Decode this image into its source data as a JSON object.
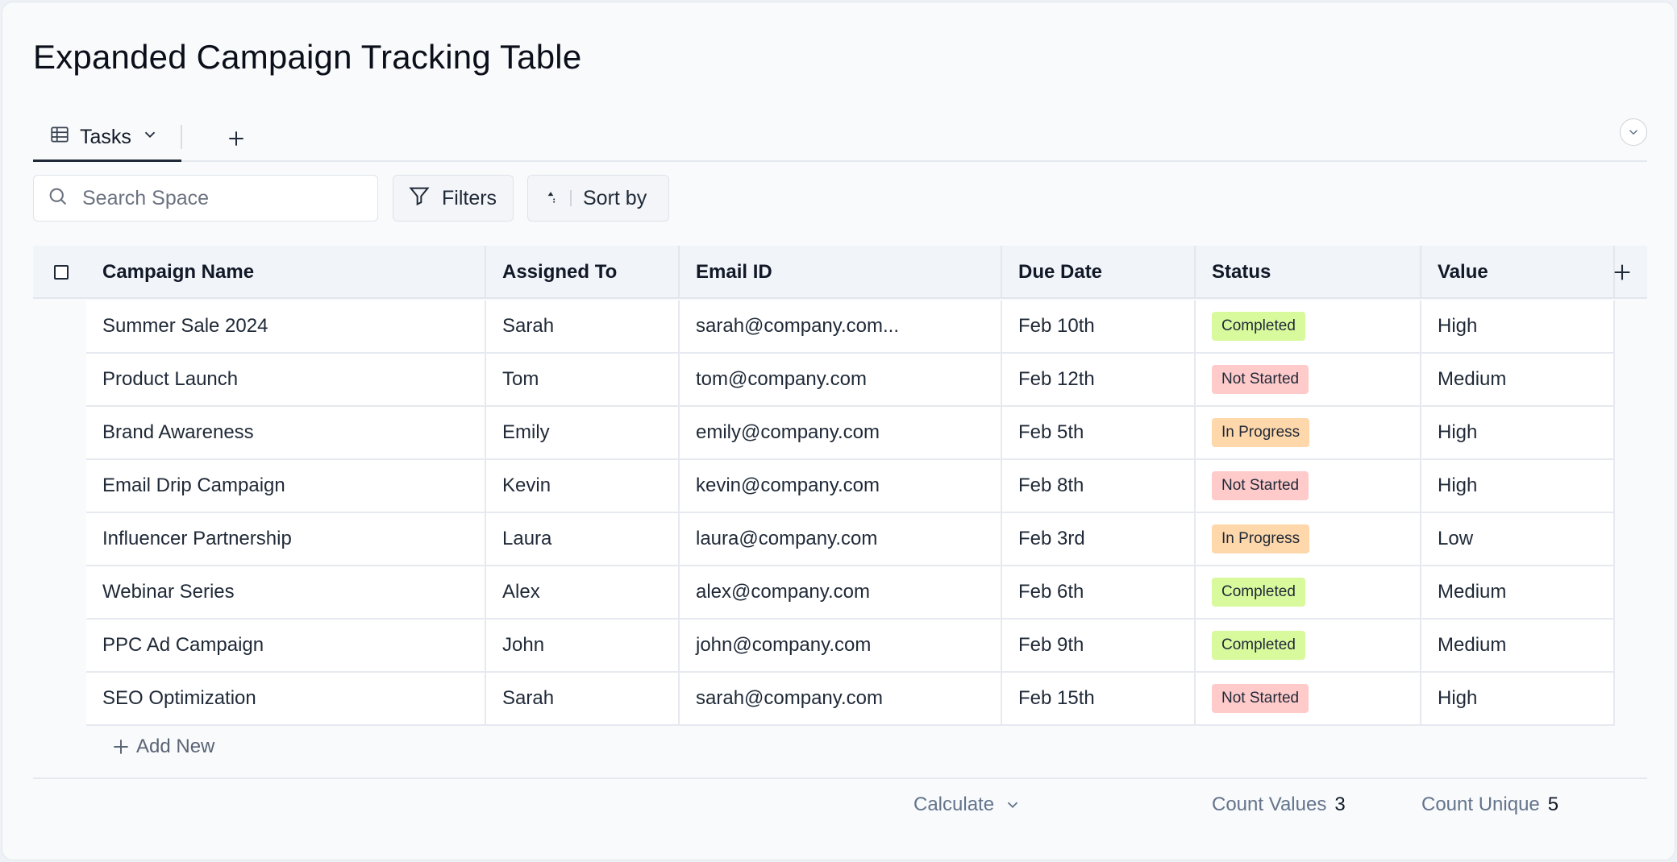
{
  "page": {
    "title": "Expanded Campaign Tracking Table"
  },
  "tabs": {
    "active_label": "Tasks"
  },
  "toolbar": {
    "search_placeholder": "Search Space",
    "filters_label": "Filters",
    "sort_label": "Sort by"
  },
  "table": {
    "columns": [
      "Campaign Name",
      "Assigned To",
      "Email ID",
      "Due Date",
      "Status",
      "Value"
    ],
    "rows": [
      {
        "name": "Summer Sale 2024",
        "assigned": "Sarah",
        "email": "sarah@company.com...",
        "due": "Feb 10th",
        "status": "Completed",
        "value": "High"
      },
      {
        "name": "Product Launch",
        "assigned": "Tom",
        "email": "tom@company.com",
        "due": "Feb 12th",
        "status": "Not Started",
        "value": "Medium"
      },
      {
        "name": "Brand Awareness",
        "assigned": "Emily",
        "email": "emily@company.com",
        "due": "Feb 5th",
        "status": "In Progress",
        "value": "High"
      },
      {
        "name": "Email Drip Campaign",
        "assigned": "Kevin",
        "email": "kevin@company.com",
        "due": "Feb 8th",
        "status": "Not Started",
        "value": "High"
      },
      {
        "name": "Influencer Partnership",
        "assigned": "Laura",
        "email": "laura@company.com",
        "due": "Feb 3rd",
        "status": "In Progress",
        "value": "Low"
      },
      {
        "name": "Webinar Series",
        "assigned": "Alex",
        "email": "alex@company.com",
        "due": "Feb 6th",
        "status": "Completed",
        "value": "Medium"
      },
      {
        "name": "PPC Ad Campaign",
        "assigned": "John",
        "email": "john@company.com",
        "due": "Feb 9th",
        "status": "Completed",
        "value": "Medium"
      },
      {
        "name": "SEO Optimization",
        "assigned": "Sarah",
        "email": "sarah@company.com",
        "due": "Feb 15th",
        "status": "Not Started",
        "value": "High"
      }
    ],
    "add_new_label": "Add New"
  },
  "status_colors": {
    "Completed": "#d9f99d",
    "Not Started": "#fecaca",
    "In Progress": "#fed7aa"
  },
  "footer": {
    "calculate_label": "Calculate",
    "count_values_label": "Count Values",
    "count_values": "3",
    "count_unique_label": "Count Unique",
    "count_unique": "5"
  }
}
